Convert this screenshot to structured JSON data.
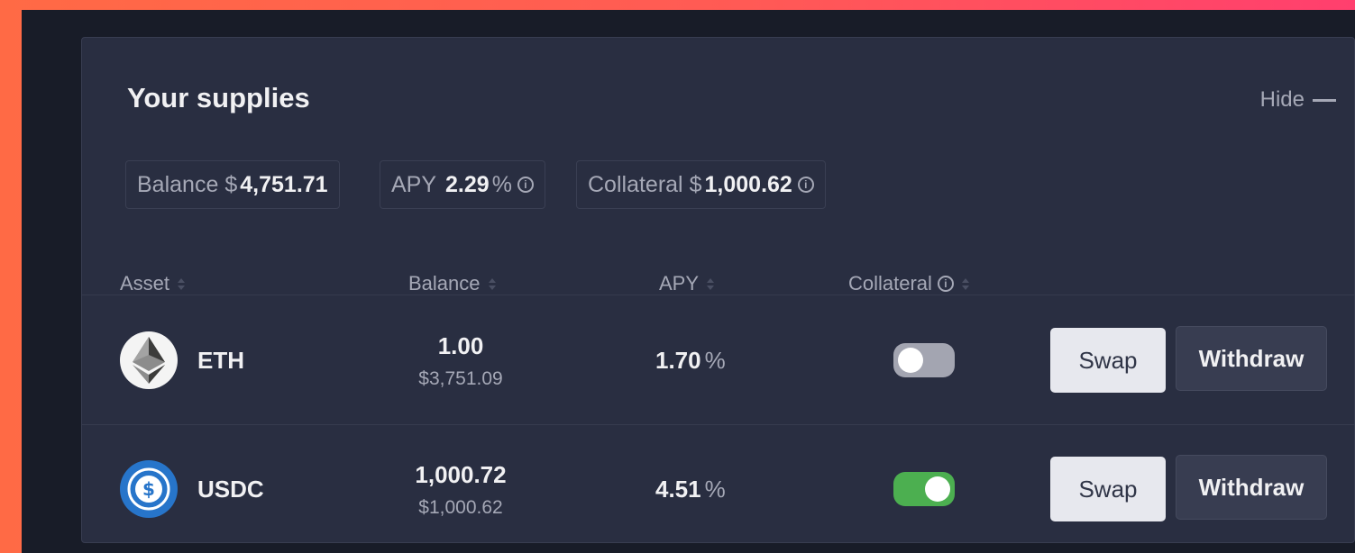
{
  "header": {
    "title": "Your supplies",
    "hide_label": "Hide"
  },
  "summary": {
    "balance": {
      "label": "Balance",
      "currency": "$",
      "value": "4,751.71"
    },
    "apy": {
      "label": "APY",
      "value": "2.29",
      "unit": "%"
    },
    "collateral": {
      "label": "Collateral",
      "currency": "$",
      "value": "1,000.62"
    }
  },
  "columns": {
    "asset": "Asset",
    "balance": "Balance",
    "apy": "APY",
    "collateral": "Collateral"
  },
  "rows": [
    {
      "asset": "ETH",
      "balance": "1.00",
      "balance_usd": "$3,751.09",
      "apy": "1.70",
      "apy_unit": "%",
      "collateral_enabled": false,
      "swap_label": "Swap",
      "withdraw_label": "Withdraw"
    },
    {
      "asset": "USDC",
      "balance": "1,000.72",
      "balance_usd": "$1,000.62",
      "apy": "4.51",
      "apy_unit": "%",
      "collateral_enabled": true,
      "swap_label": "Swap",
      "withdraw_label": "Withdraw"
    }
  ],
  "icons": {
    "eth": "ethereum-icon",
    "usdc": "usdc-icon",
    "info": "info-icon",
    "sort": "sort-icon",
    "hide": "minus-icon"
  },
  "colors": {
    "toggle_on": "#4caf50",
    "toggle_off": "#a3a5b1",
    "usdc_brand": "#2775ca"
  }
}
